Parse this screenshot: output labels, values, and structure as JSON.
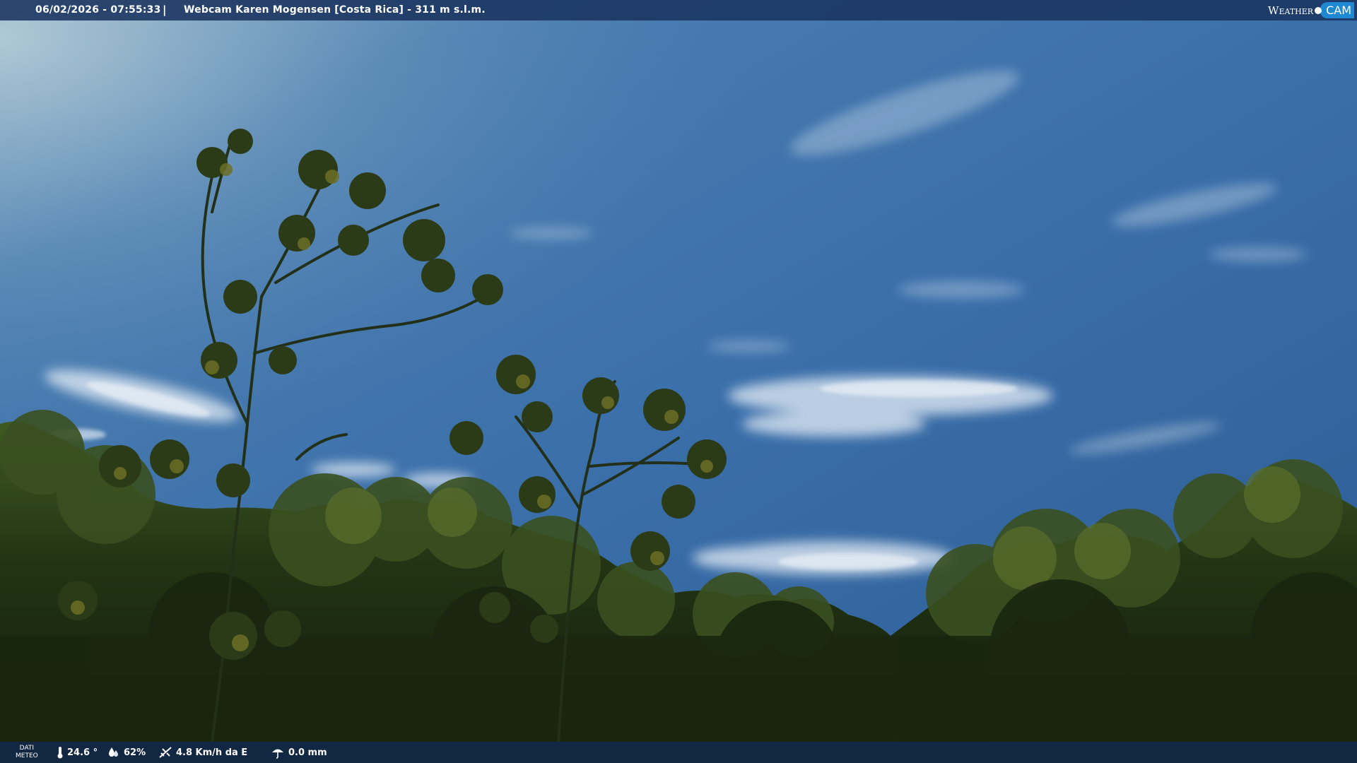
{
  "header": {
    "timestamp": "06/02/2026 - 07:55:33",
    "separator": "|",
    "title": "Webcam Karen Mogensen [Costa Rica]  - 311 m s.l.m.",
    "logo": {
      "word": "Weather",
      "cam": "CAM"
    }
  },
  "footer": {
    "label_line1": "DATI",
    "label_line2": "METEO",
    "temperature": "24.6 °",
    "humidity": "62%",
    "wind": "4.8 Km/h da E",
    "rain": "0.0 mm"
  },
  "icons": {
    "temperature": "thermometer-icon",
    "humidity": "humidity-drop-icon",
    "wind": "wind-icon",
    "rain": "rain-icon"
  },
  "colors": {
    "sky_top": "#2e5586",
    "sky_mid": "#3f77b4",
    "foliage_dark": "#1d2a10",
    "foliage_light": "#6e7a2a",
    "bar": "#1a3460",
    "logo_accent": "#1e88d2"
  }
}
